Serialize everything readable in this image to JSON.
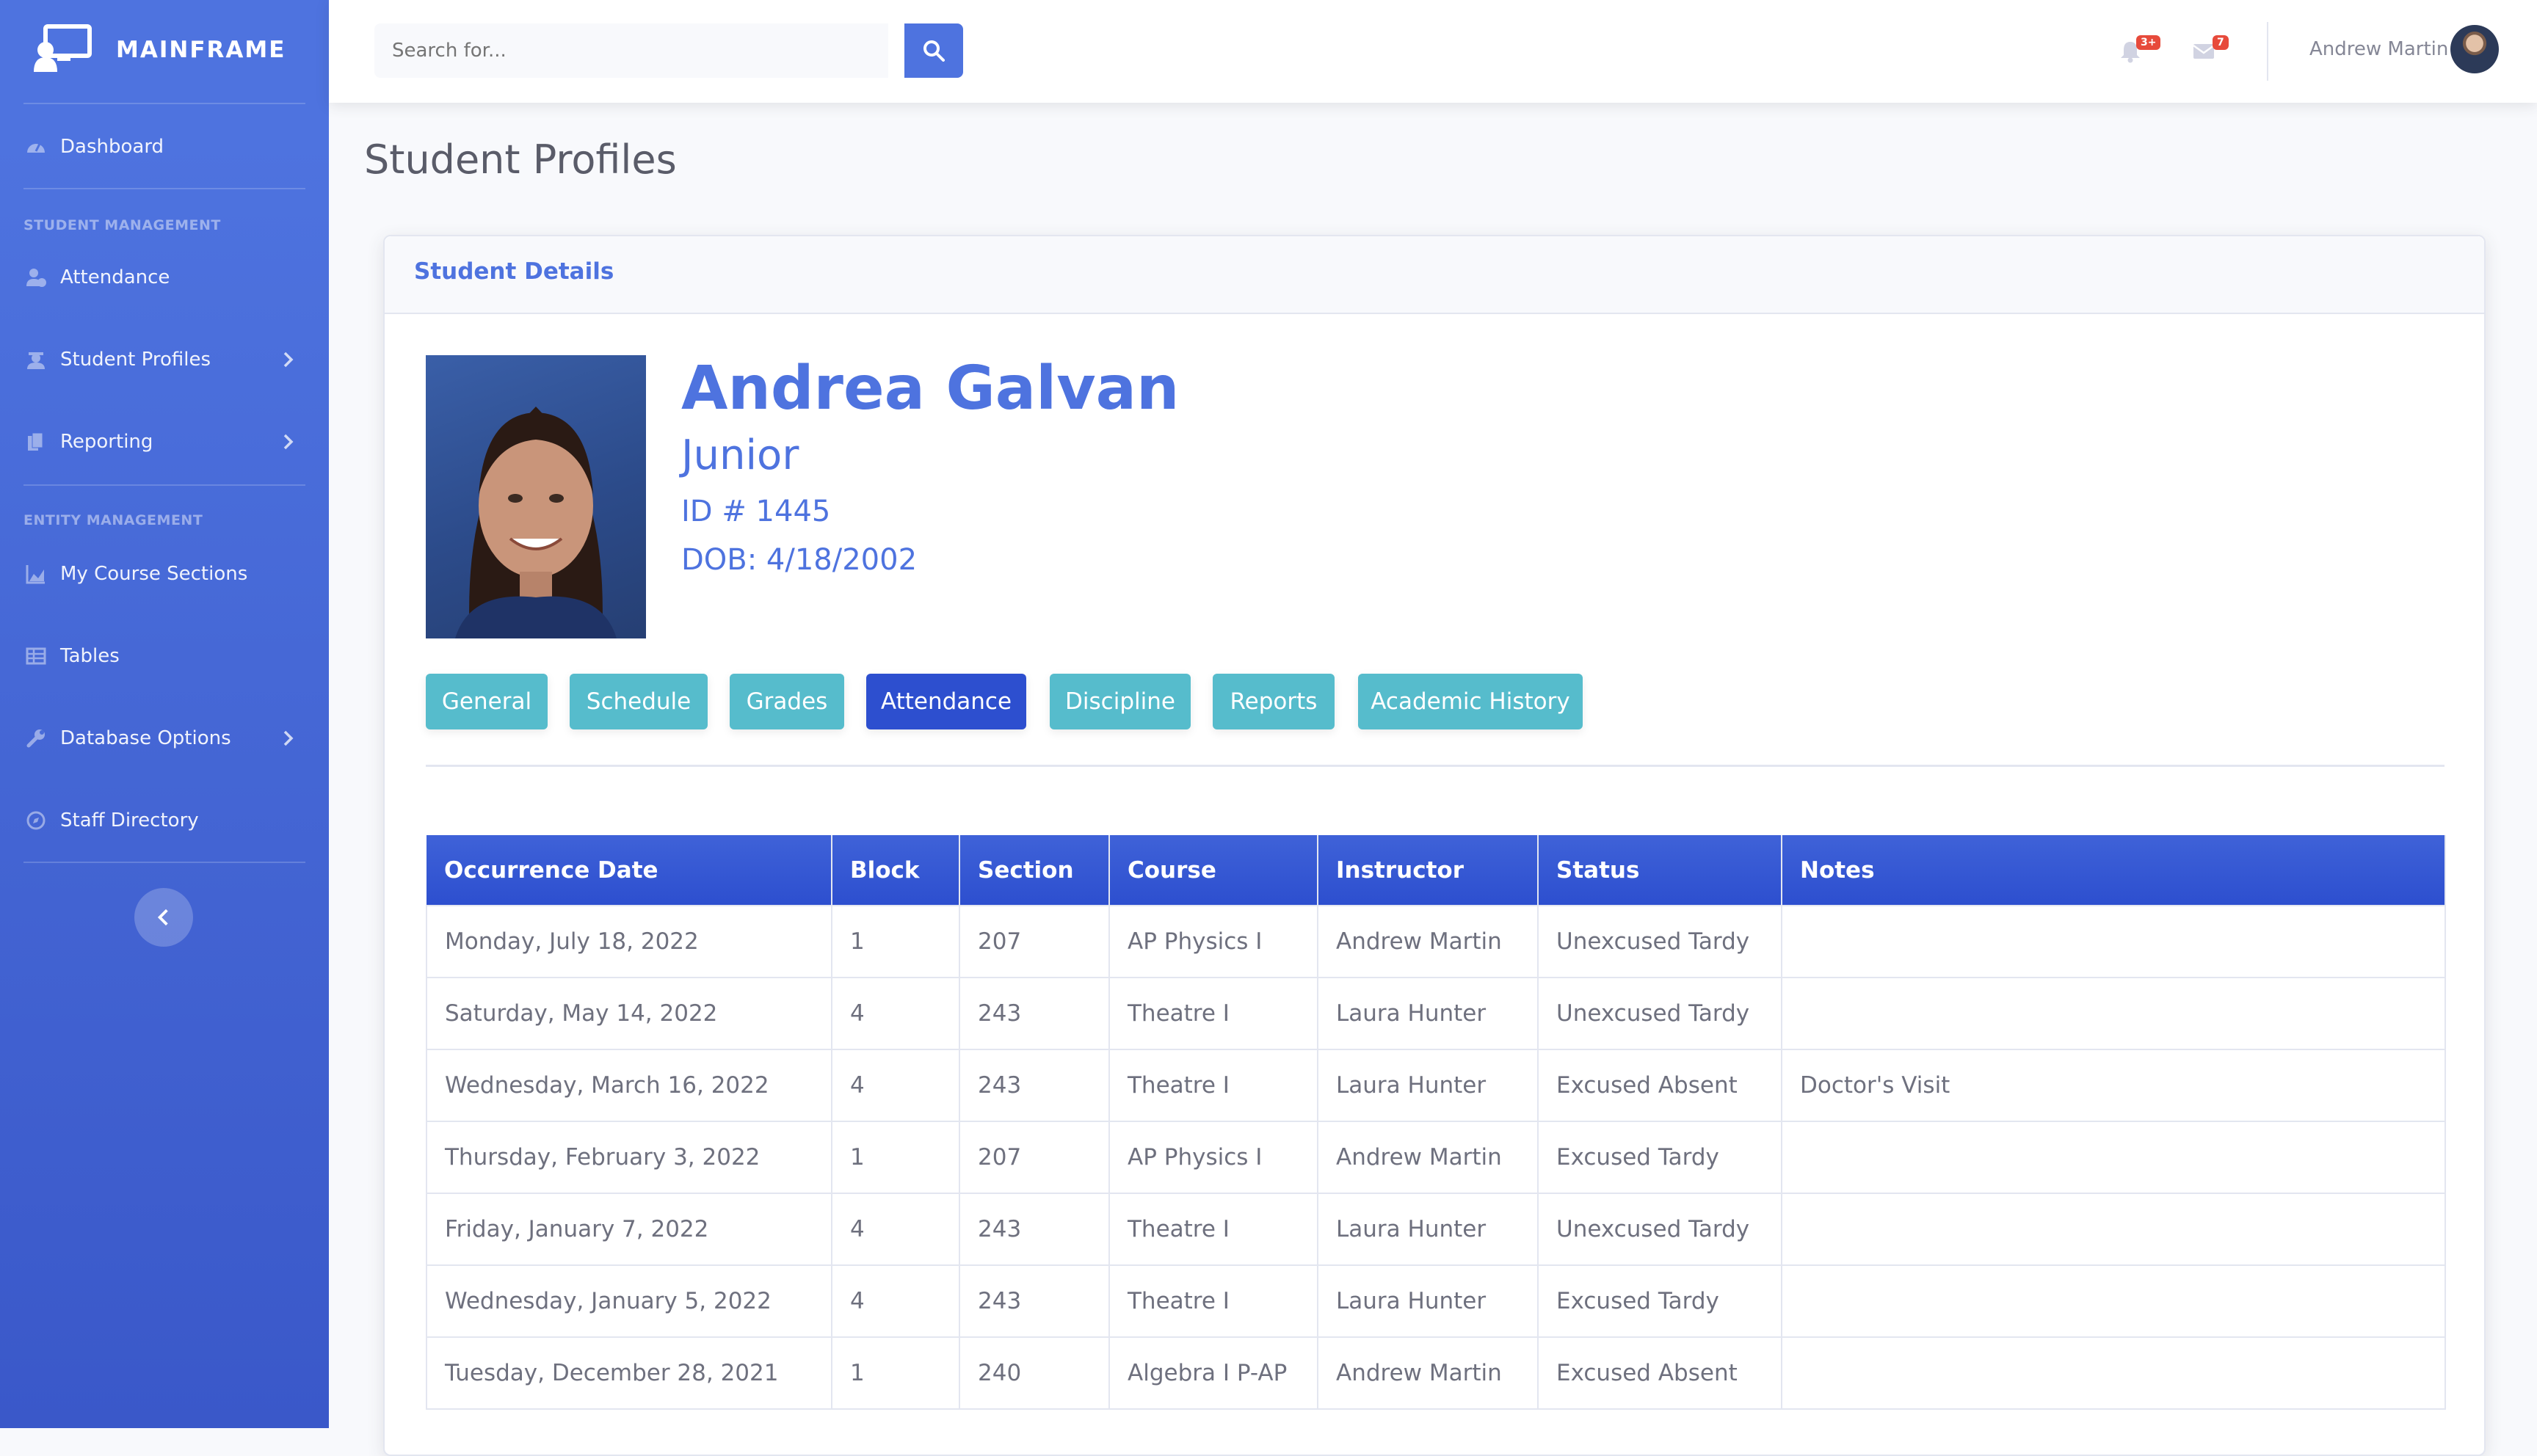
{
  "brand": {
    "name": "MAINFRAME"
  },
  "sidebar": {
    "dashboard": "Dashboard",
    "heading_student": "STUDENT MANAGEMENT",
    "attendance": "Attendance",
    "student_profiles": "Student Profiles",
    "reporting": "Reporting",
    "heading_entity": "ENTITY MANAGEMENT",
    "my_course_sections": "My Course Sections",
    "tables": "Tables",
    "database_options": "Database Options",
    "staff_directory": "Staff Directory"
  },
  "topbar": {
    "search_placeholder": "Search for...",
    "alerts_badge": "3+",
    "messages_badge": "7",
    "user_name": "Andrew Martin"
  },
  "page": {
    "title": "Student Profiles",
    "card_title": "Student Details"
  },
  "student": {
    "name": "Andrea Galvan",
    "grade": "Junior",
    "id": "ID # 1445",
    "dob": "DOB: 4/18/2002"
  },
  "tabs": [
    "General",
    "Schedule",
    "Grades",
    "Attendance",
    "Discipline",
    "Reports",
    "Academic History"
  ],
  "active_tab": "Attendance",
  "table": {
    "headers": [
      "Occurrence Date",
      "Block",
      "Section",
      "Course",
      "Instructor",
      "Status",
      "Notes"
    ],
    "rows": [
      [
        "Monday, July 18, 2022",
        "1",
        "207",
        "AP Physics I",
        "Andrew Martin",
        "Unexcused Tardy",
        ""
      ],
      [
        "Saturday, May 14, 2022",
        "4",
        "243",
        "Theatre I",
        "Laura Hunter",
        "Unexcused Tardy",
        ""
      ],
      [
        "Wednesday, March 16, 2022",
        "4",
        "243",
        "Theatre I",
        "Laura Hunter",
        "Excused Absent",
        "Doctor's Visit"
      ],
      [
        "Thursday, February 3, 2022",
        "1",
        "207",
        "AP Physics I",
        "Andrew Martin",
        "Excused Tardy",
        ""
      ],
      [
        "Friday, January 7, 2022",
        "4",
        "243",
        "Theatre I",
        "Laura Hunter",
        "Unexcused Tardy",
        ""
      ],
      [
        "Wednesday, January 5, 2022",
        "4",
        "243",
        "Theatre I",
        "Laura Hunter",
        "Excused Tardy",
        ""
      ],
      [
        "Tuesday, December 28, 2021",
        "1",
        "240",
        "Algebra I P-AP",
        "Andrew Martin",
        "Excused Absent",
        ""
      ]
    ]
  },
  "icons": {
    "brand": "classroom-icon",
    "dashboard": "tachometer-icon",
    "attendance": "user-clock-icon",
    "student_profiles": "user-graduate-icon",
    "reporting": "copy-icon",
    "my_course_sections": "chart-area-icon",
    "tables": "table-icon",
    "database_options": "wrench-icon",
    "staff_directory": "compass-icon",
    "search": "search-icon",
    "alerts": "bell-icon",
    "messages": "envelope-icon"
  },
  "colors": {
    "primary": "#4e73df",
    "active_tab": "#2d4fcf",
    "tab": "#56bccc",
    "badge": "#e74a3b"
  }
}
